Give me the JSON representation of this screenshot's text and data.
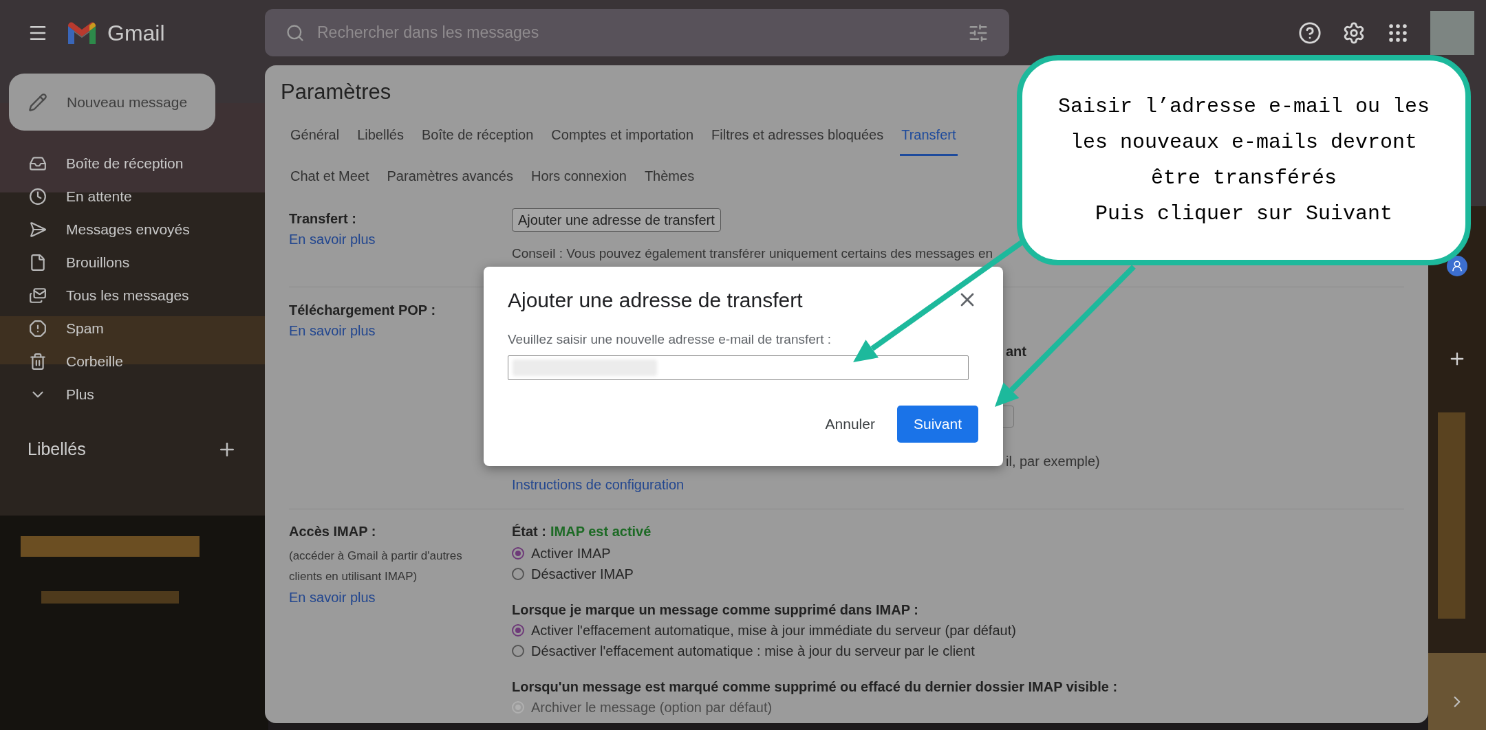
{
  "app": {
    "name": "Gmail"
  },
  "search": {
    "placeholder": "Rechercher dans les messages"
  },
  "compose": {
    "label": "Nouveau message"
  },
  "nav": [
    {
      "label": "Boîte de réception",
      "kind": "inbox"
    },
    {
      "label": "En attente",
      "kind": "snoozed"
    },
    {
      "label": "Messages envoyés",
      "kind": "sent"
    },
    {
      "label": "Brouillons",
      "kind": "drafts"
    },
    {
      "label": "Tous les messages",
      "kind": "all"
    },
    {
      "label": "Spam",
      "kind": "spam"
    },
    {
      "label": "Corbeille",
      "kind": "trash"
    },
    {
      "label": "Plus",
      "kind": "more"
    }
  ],
  "labels_header": "Libellés",
  "settings": {
    "title": "Paramètres",
    "tab_rows": [
      [
        {
          "label": "Général",
          "selected": false
        },
        {
          "label": "Libellés",
          "selected": false
        },
        {
          "label": "Boîte de réception",
          "selected": false
        },
        {
          "label": "Comptes et importation",
          "selected": false
        },
        {
          "label": "Filtres et adresses bloquées",
          "selected": false
        },
        {
          "label": "Transfert",
          "selected": true
        }
      ],
      [
        {
          "label": "Chat et Meet",
          "selected": false
        },
        {
          "label": "Paramètres avancés",
          "selected": false
        },
        {
          "label": "Hors connexion",
          "selected": false
        },
        {
          "label": "Thèmes",
          "selected": false
        }
      ]
    ],
    "forwarding": {
      "label": "Transfert :",
      "link": "En savoir plus",
      "button": "Ajouter une adresse de transfert",
      "tip": "Conseil : Vous pouvez également transférer uniquement certains des messages en"
    },
    "pop": {
      "label": "Téléchargement POP :",
      "link": "En savoir plus",
      "heading_fragment": "ant",
      "note_fragment": "il, par exemple)",
      "instructions_link": "Instructions de configuration"
    },
    "imap": {
      "label": "Accès IMAP :",
      "note": "(accéder à Gmail à partir d'autres clients en utilisant IMAP)",
      "link": "En savoir plus",
      "status_label": "État :",
      "status_value": "IMAP est activé",
      "groups": [
        {
          "options": [
            {
              "label": "Activer IMAP",
              "selected": true,
              "disabled": false
            },
            {
              "label": "Désactiver IMAP",
              "selected": false,
              "disabled": false
            }
          ]
        },
        {
          "heading": "Lorsque je marque un message comme supprimé dans IMAP :",
          "options": [
            {
              "label": "Activer l'effacement automatique, mise à jour immédiate du serveur (par défaut)",
              "selected": true,
              "disabled": false
            },
            {
              "label": "Désactiver l'effacement automatique : mise à jour du serveur par le client",
              "selected": false,
              "disabled": false
            }
          ]
        },
        {
          "heading": "Lorsqu'un message est marqué comme supprimé ou effacé du dernier dossier IMAP visible :",
          "options": [
            {
              "label": "Archiver le message (option par défaut)",
              "selected": true,
              "disabled": true
            }
          ]
        }
      ]
    }
  },
  "dialog": {
    "title": "Ajouter une adresse de transfert",
    "field_label": "Veuillez saisir une nouvelle adresse e-mail de transfert :",
    "buttons": [
      {
        "label": "Annuler",
        "kind": "text"
      },
      {
        "label": "Suivant",
        "kind": "primary"
      }
    ]
  },
  "callout": {
    "text": "Saisir l’adresse e-mail ou les\nles nouveaux e-mails devront\nêtre transférés\nPuis cliquer sur Suivant"
  }
}
